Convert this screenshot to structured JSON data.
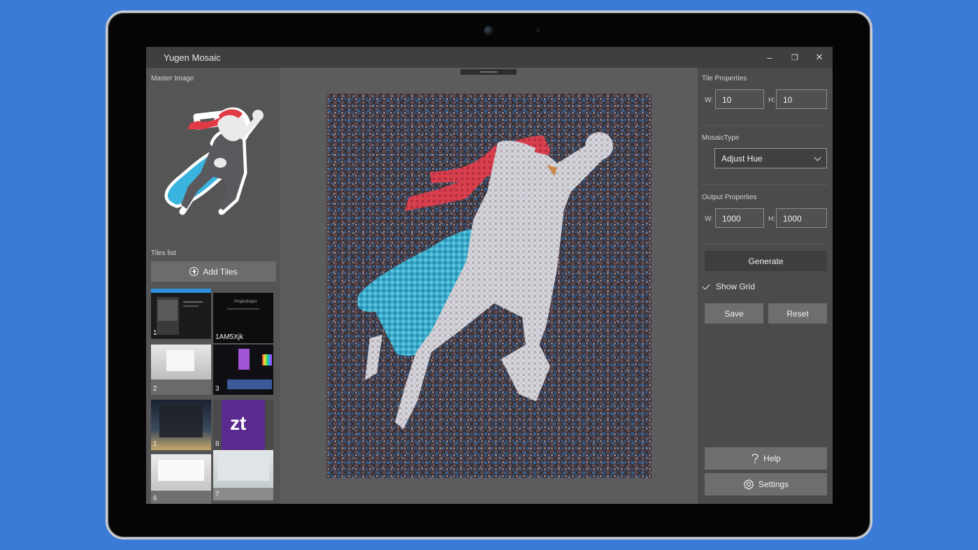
{
  "window": {
    "title": "Yugen Mosaic",
    "minimize": "–",
    "restore": "❐",
    "close": "✕"
  },
  "left": {
    "master_label": "Master Image",
    "tiles_label": "Tiles list",
    "add_tiles": "Add Tiles",
    "tiles": [
      {
        "num": "1",
        "caption": ""
      },
      {
        "num": "",
        "caption": "1AM5Xjk",
        "inner_text": "ProjectInput"
      },
      {
        "num": "2",
        "caption": ""
      },
      {
        "num": "3",
        "caption": ""
      },
      {
        "num": "1",
        "caption": ""
      },
      {
        "num": "8",
        "caption": "",
        "inner_text": "zt"
      },
      {
        "num": "6",
        "caption": ""
      },
      {
        "num": "7",
        "caption": ""
      }
    ]
  },
  "right": {
    "tile_props": "Tile Properties",
    "w_label": "W:",
    "h_label": "H:",
    "tile_w": "10",
    "tile_h": "10",
    "mosaic_type_label": "MosaicType",
    "mosaic_type": "Adjust Hue",
    "output_props": "Output Properties",
    "out_w": "1000",
    "out_h": "1000",
    "generate": "Generate",
    "show_grid": "Show Grid",
    "save": "Save",
    "reset": "Reset",
    "help": "Help",
    "settings": "Settings"
  },
  "colors": {
    "cape": "#3ab4de",
    "scarf": "#e03a46",
    "body": "#5a5a5e",
    "page_bg": "#3a7bd8"
  }
}
